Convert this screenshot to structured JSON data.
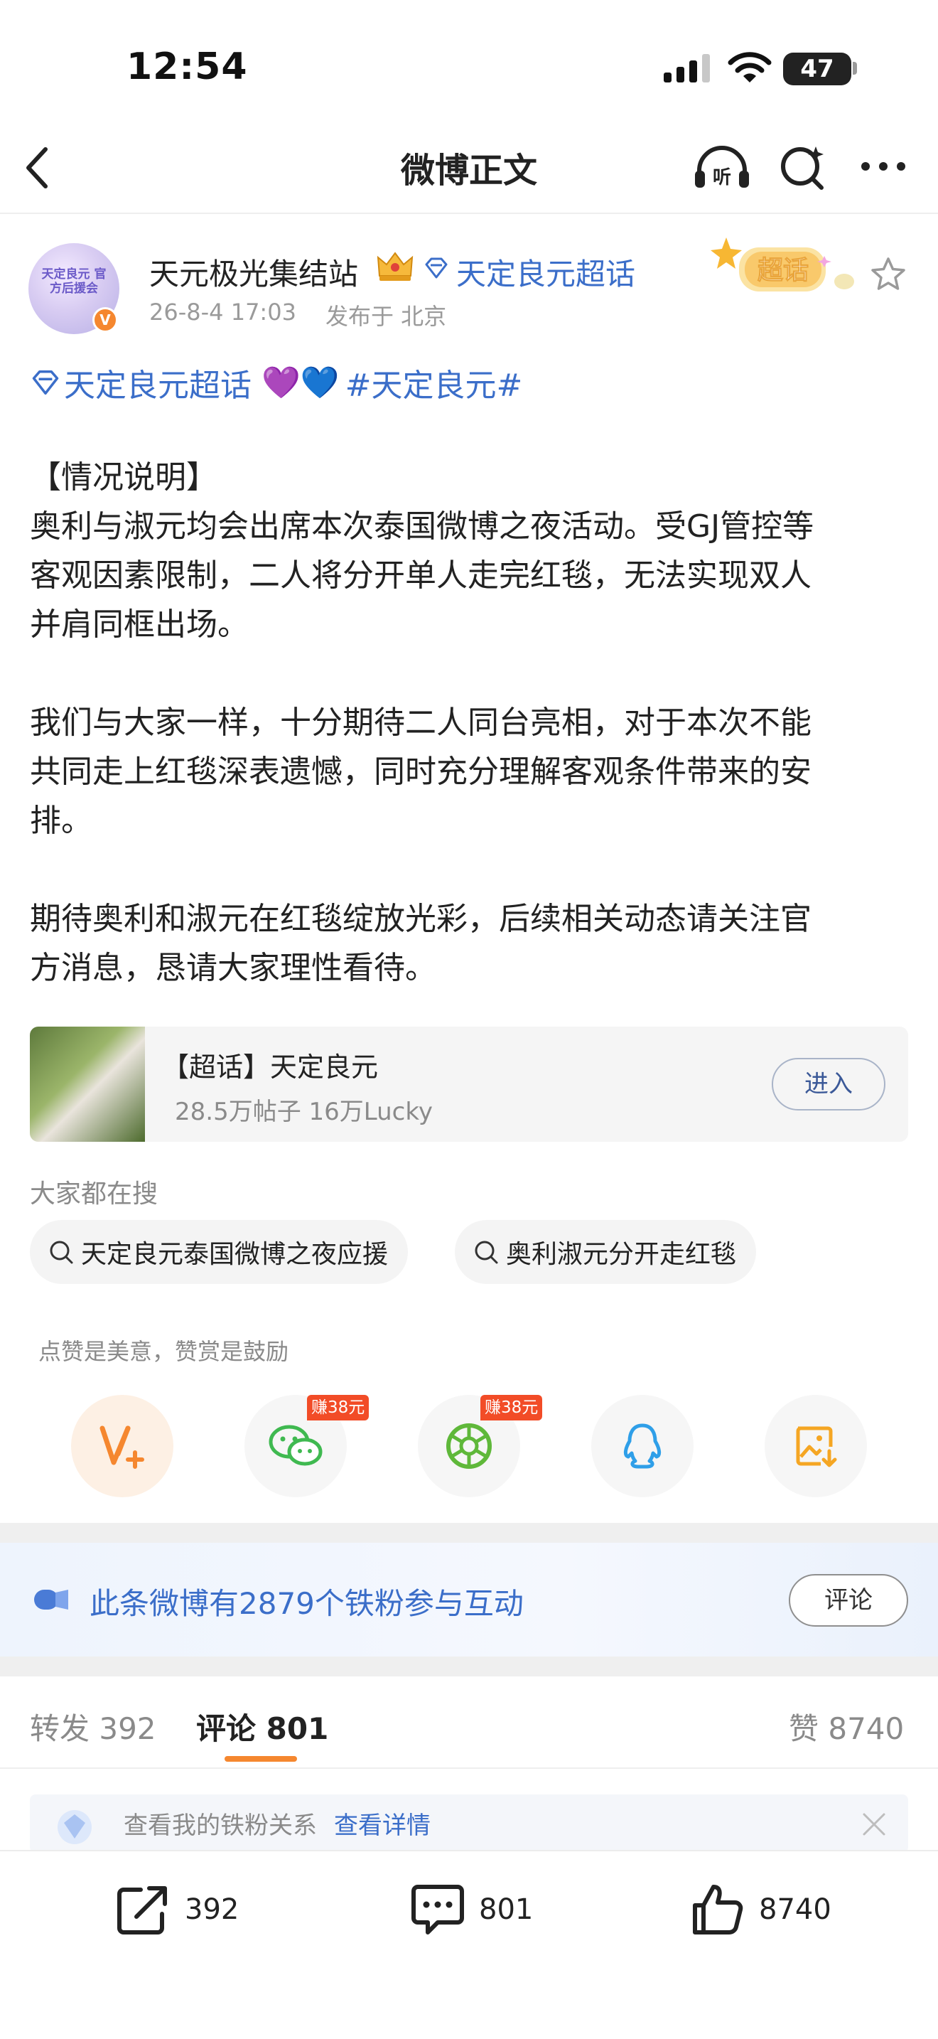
{
  "status_bar": {
    "time": "12:54",
    "battery": "47"
  },
  "nav": {
    "title": "微博正文"
  },
  "post": {
    "author": {
      "name": "天元极光集结站",
      "avatar_text": "天定良元 官方后援会",
      "verified": "V",
      "topic": "天定良元超话"
    },
    "time": "26-8-4 17:03",
    "location": "发布于 北京",
    "badge": "超话",
    "topic_line": {
      "topic": "天定良元超话",
      "emoji": "💜💙",
      "hashtag": "#天定良元#"
    },
    "paragraphs": [
      [
        "【情况说明】",
        "奥利与淑元均会出席本次泰国微博之夜活动。受GJ管控等",
        "客观因素限制，二人将分开单人走完红毯，无法实现双人",
        "并肩同框出场。"
      ],
      [
        "我们与大家一样，十分期待二人同台亮相，对于本次不能",
        "共同走上红毯深表遗憾，同时充分理解客观条件带来的安",
        "排。"
      ],
      [
        "期待奥利和淑元在红毯绽放光彩，后续相关动态请关注官",
        "方消息，恳请大家理性看待。"
      ]
    ]
  },
  "supertopic_card": {
    "title": "【超话】天定良元",
    "subtitle": "28.5万帖子 16万Lucky",
    "button": "进入"
  },
  "search": {
    "label": "大家都在搜",
    "chips": [
      "天定良元泰国微博之夜应援",
      "奥利淑元分开走红毯"
    ]
  },
  "share": {
    "tip": "点赞是美意，赞赏是鼓励",
    "earn_badge": "赚38元",
    "items": [
      "reward-icon",
      "wechat-icon",
      "moments-icon",
      "qq-icon",
      "save-image-icon"
    ]
  },
  "fans_banner": {
    "text": "此条微博有2879个铁粉参与互动",
    "button": "评论"
  },
  "tabs": {
    "repost": "转发 392",
    "comment": "评论 801",
    "like": "赞 8740"
  },
  "fans_relation": {
    "text": "查看我的铁粉关系",
    "link": "查看详情"
  },
  "bottom_bar": {
    "repost": "392",
    "comment": "801",
    "like": "8740"
  },
  "colors": {
    "link_blue": "#3b6ec9",
    "accent_orange": "#f5872f",
    "earn_red": "#f24c27"
  }
}
